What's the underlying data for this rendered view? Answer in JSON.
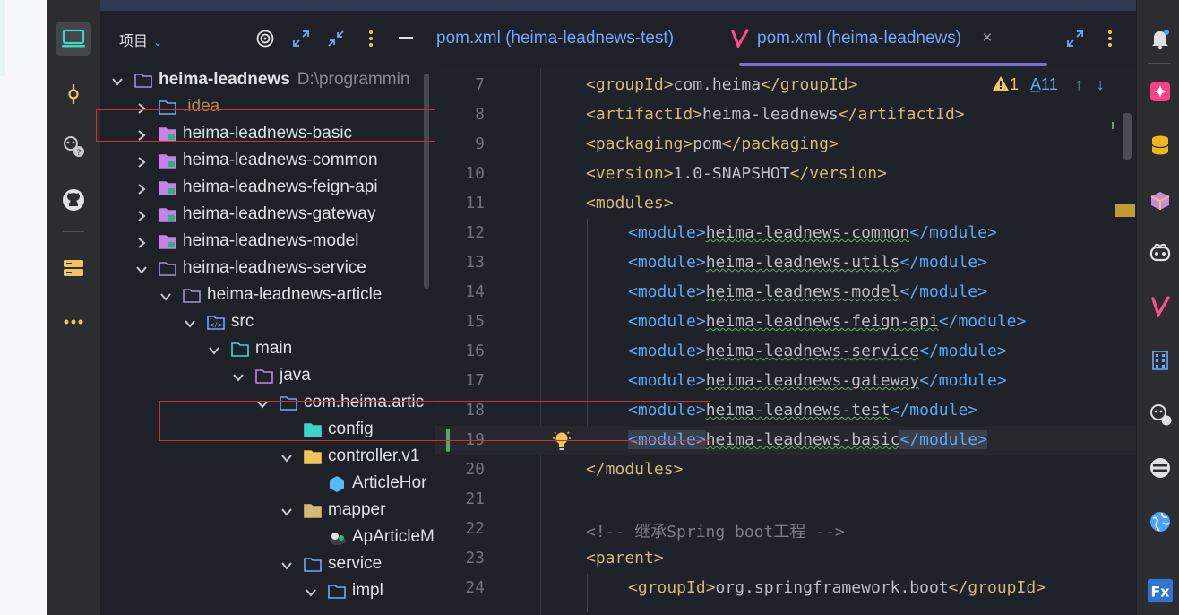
{
  "project_panel": {
    "title": "项目",
    "tree": [
      {
        "label": "heima-leadnews",
        "path": "D:\\programmin",
        "bold": true,
        "icon": "folder-icon"
      },
      {
        "label": ".idea",
        "icon": "idea-folder-icon",
        "dim": true
      },
      {
        "label": "heima-leadnews-basic",
        "icon": "module-folder-icon"
      },
      {
        "label": "heima-leadnews-common",
        "icon": "module-folder-icon"
      },
      {
        "label": "heima-leadnews-feign-api",
        "icon": "module-folder-icon"
      },
      {
        "label": "heima-leadnews-gateway",
        "icon": "module-folder-icon"
      },
      {
        "label": "heima-leadnews-model",
        "icon": "module-folder-icon"
      },
      {
        "label": "heima-leadnews-service",
        "icon": "folder-icon"
      },
      {
        "label": "heima-leadnews-article",
        "icon": "folder-icon"
      },
      {
        "label": "src",
        "icon": "source-folder-icon"
      },
      {
        "label": "main",
        "icon": "main-folder-icon"
      },
      {
        "label": "java",
        "icon": "java-folder-icon"
      },
      {
        "label": "com.heima.artic",
        "icon": "package-icon"
      },
      {
        "label": "config",
        "icon": "config-folder-icon"
      },
      {
        "label": "controller.v1",
        "icon": "controller-folder-icon"
      },
      {
        "label": "ArticleHor",
        "icon": "java-class-icon"
      },
      {
        "label": "mapper",
        "icon": "mapper-folder-icon"
      },
      {
        "label": "ApArticleM",
        "icon": "mybatis-icon"
      },
      {
        "label": "service",
        "icon": "service-folder-icon"
      },
      {
        "label": "impl",
        "icon": "package-icon"
      }
    ]
  },
  "editor": {
    "tabs": [
      {
        "label": "pom.xml (heima-leadnews-test)",
        "active": false
      },
      {
        "label": "pom.xml (heima-leadnews)",
        "active": true,
        "close": "×"
      }
    ],
    "inspections": {
      "warnings": "1",
      "typos": "11"
    },
    "lines": [
      {
        "n": "7",
        "open": "<groupId>",
        "text": "com.heima",
        "close": "</groupId>",
        "indent": 1
      },
      {
        "n": "8",
        "open": "<artifactId>",
        "text": "heima-leadnews",
        "close": "</artifactId>",
        "indent": 1
      },
      {
        "n": "9",
        "open": "<packaging>",
        "text": "pom",
        "close": "</packaging>",
        "indent": 1
      },
      {
        "n": "10",
        "open": "<version>",
        "text": "1.0-SNAPSHOT",
        "close": "</version>",
        "indent": 1
      },
      {
        "n": "11",
        "open": "<modules>",
        "text": "",
        "close": "",
        "indent": 1
      },
      {
        "n": "12",
        "open": "<module>",
        "text": "heima-leadnews-common",
        "close": "</module>",
        "indent": 2
      },
      {
        "n": "13",
        "open": "<module>",
        "text": "heima-leadnews-utils",
        "close": "</module>",
        "indent": 2
      },
      {
        "n": "14",
        "open": "<module>",
        "text": "heima-leadnews-model",
        "close": "</module>",
        "indent": 2
      },
      {
        "n": "15",
        "open": "<module>",
        "text": "heima-leadnews-feign-api",
        "close": "</module>",
        "indent": 2
      },
      {
        "n": "16",
        "open": "<module>",
        "text": "heima-leadnews-service",
        "close": "</module>",
        "indent": 2
      },
      {
        "n": "17",
        "open": "<module>",
        "text": "heima-leadnews-gateway",
        "close": "</module>",
        "indent": 2
      },
      {
        "n": "18",
        "open": "<module>",
        "text": "heima-leadnews-test",
        "close": "</module>",
        "indent": 2
      },
      {
        "n": "19",
        "open": "<module>",
        "text": "heima-leadnews-basic",
        "close": "</module>",
        "indent": 2
      },
      {
        "n": "20",
        "open": "</modules>",
        "text": "",
        "close": "",
        "indent": 1
      },
      {
        "n": "21",
        "open": "",
        "text": "",
        "close": "",
        "indent": 1
      },
      {
        "n": "22",
        "comment": "<!-- 继承Spring boot工程 -->",
        "indent": 1
      },
      {
        "n": "23",
        "open": "<parent>",
        "text": "",
        "close": "",
        "indent": 1
      },
      {
        "n": "24",
        "open": "<groupId>",
        "text": "org.springframework.boot",
        "close": "</groupId>",
        "indent": 2
      }
    ]
  },
  "colors": {
    "tag": "#d5b778",
    "module_tag": "#56a8f5",
    "highlight_box": "#d32f2f"
  }
}
